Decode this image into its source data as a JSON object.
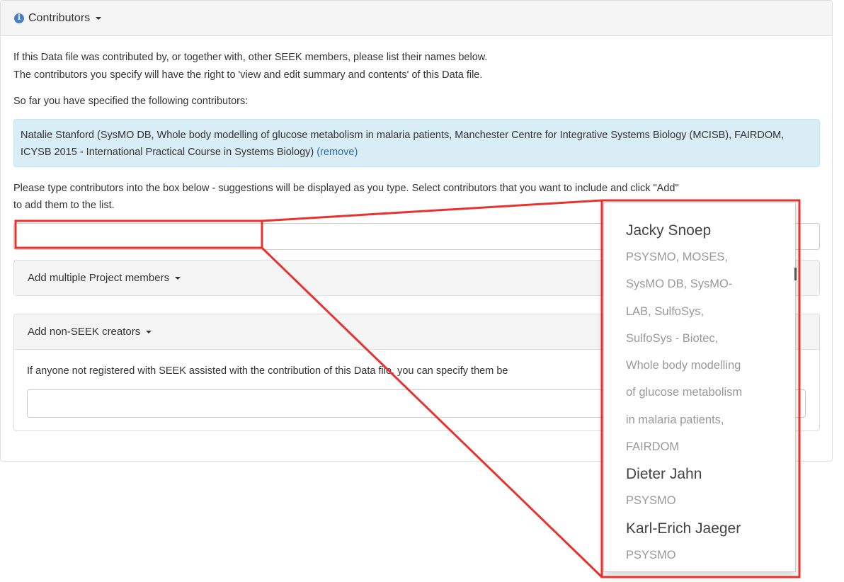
{
  "panel": {
    "title": "Contributors",
    "intro_line1": "If this Data file was contributed by, or together with, other SEEK members, please list their names below.",
    "intro_line2": "The contributors you specify will have the right to 'view and edit summary and contents' of this Data file.",
    "so_far": "So far you have specified the following contributors:",
    "contributor_text": "Natalie Stanford (SysMO DB, Whole body modelling of glucose metabolism in malaria patients, Manchester Centre for Integrative Systems Biology (MCISB), FAIRDOM, ICYSB 2015 - International Practical Course in Systems Biology)",
    "remove_label": "(remove)",
    "instructions_line1": "Please type contributors into the box below - suggestions will be displayed as you type. Select contributors that you want to include and click \"Add\"",
    "instructions_line2": "to add them to the list.",
    "contributor_input_value": "",
    "add_multiple_label": "Add multiple Project members",
    "non_seek_label": "Add non-SEEK creators",
    "non_seek_help": "If anyone not registered with SEEK assisted with the contribution of this Data file, you can specify them be",
    "non_seek_input_value": ""
  },
  "suggestions": [
    {
      "name": "Jacky Snoep",
      "projects": [
        "PSYSMO, MOSES,",
        "SysMO DB, SysMO-",
        "LAB, SulfoSys,",
        "SulfoSys - Biotec,",
        "Whole body modelling",
        "of glucose metabolism",
        "in malaria patients,",
        "FAIRDOM"
      ]
    },
    {
      "name": "Dieter Jahn",
      "projects": [
        "PSYSMO"
      ]
    },
    {
      "name": "Karl-Erich Jaeger",
      "projects": [
        "PSYSMO"
      ]
    }
  ],
  "colors": {
    "callout_red": "#e8322d",
    "alert_bg": "#d9edf7",
    "link_blue": "#2a6db5",
    "heading_bg": "#f5f5f5"
  },
  "icons": {
    "heading": "info-icon",
    "caret": "caret-down-icon"
  }
}
